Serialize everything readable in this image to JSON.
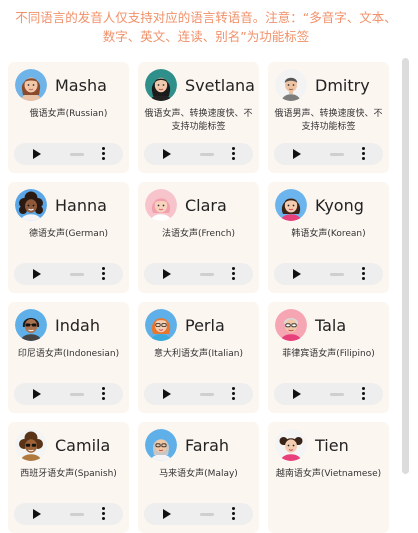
{
  "notice": "不同语言的发音人仅支持对应的语言转语音。注意：“多音字、文本、数字、英文、连读、别名”为功能标签",
  "colors": {
    "accent": "#f0916a",
    "card": "#fcf6f1",
    "player": "#eeeeee"
  },
  "voices": [
    {
      "name": "Masha",
      "desc": "俄语女声(Russian)",
      "avatar": "woman-brown-hair-icon"
    },
    {
      "name": "Svetlana",
      "desc": "俄语女声、转换速度快、不支持功能标签",
      "avatar": "woman-black-hair-icon"
    },
    {
      "name": "Dmitry",
      "desc": "俄语男声、转换速度快、不支持功能标签",
      "avatar": "man-gray-icon"
    },
    {
      "name": "Hanna",
      "desc": "德语女声(German)",
      "avatar": "woman-curly-hair-icon"
    },
    {
      "name": "Clara",
      "desc": "法语女声(French)",
      "avatar": "woman-pink-hair-icon"
    },
    {
      "name": "Kyong",
      "desc": "韩语女声(Korean)",
      "avatar": "woman-pink-shirt-icon"
    },
    {
      "name": "Indah",
      "desc": "印尼语女声(Indonesian)",
      "avatar": "woman-sunglasses-icon"
    },
    {
      "name": "Perla",
      "desc": "意大利语女声(Italian)",
      "avatar": "woman-orange-hair-icon"
    },
    {
      "name": "Tala",
      "desc": "菲律宾语女声(Filipino)",
      "avatar": "woman-glasses-icon"
    },
    {
      "name": "Camila",
      "desc": "西班牙语女声(Spanish)",
      "avatar": "woman-dark-curly-icon"
    },
    {
      "name": "Farah",
      "desc": "马来语女声(Malay)",
      "avatar": "woman-headscarf-icon"
    },
    {
      "name": "Tien",
      "desc": "越南语女声(Vietnamese)",
      "avatar": "woman-bun-icon"
    }
  ]
}
